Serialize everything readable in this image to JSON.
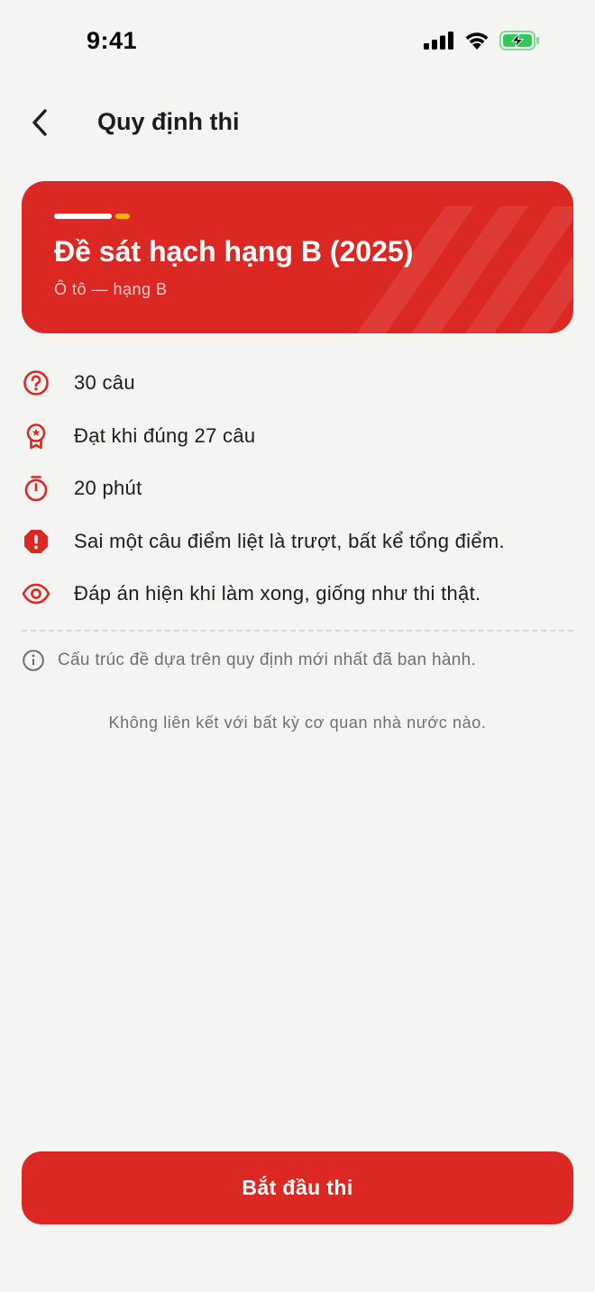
{
  "status_bar": {
    "time": "9:41",
    "icons": [
      "signal-icon",
      "wifi-icon",
      "battery-charging-icon"
    ],
    "battery_color": "#34c759"
  },
  "header": {
    "back_icon": "chevron-left-icon",
    "title": "Quy định thi"
  },
  "hero": {
    "title": "Đề sát hạch hạng B (2025)",
    "subtitle": "Ô tô — hạng B",
    "background_color": "#dc2823",
    "accent_colors": [
      "#ffffff",
      "#f7b500"
    ]
  },
  "rules": [
    {
      "icon": "question-circle-icon",
      "text": "30 câu"
    },
    {
      "icon": "award-badge-icon",
      "text": "Đạt khi đúng 27 câu"
    },
    {
      "icon": "stopwatch-icon",
      "text": "20 phút"
    },
    {
      "icon": "alert-octagon-icon",
      "text": "Sai một câu điểm liệt là trượt, bất kể tổng điểm."
    },
    {
      "icon": "eye-icon",
      "text": "Đáp án hiện khi làm xong, giống như thi thật."
    }
  ],
  "info_note": {
    "icon": "info-circle-icon",
    "text": "Cấu trúc đề dựa trên quy định mới nhất đã ban hành."
  },
  "disclaimer": "Không liên kết với bất kỳ cơ quan nhà nước nào.",
  "start_button": {
    "label": "Bắt đầu thi"
  },
  "colors": {
    "primary": "#dc2823",
    "background": "#f4f4f2",
    "text": "#1c1c1e",
    "muted_text": "#6f6f6f"
  }
}
